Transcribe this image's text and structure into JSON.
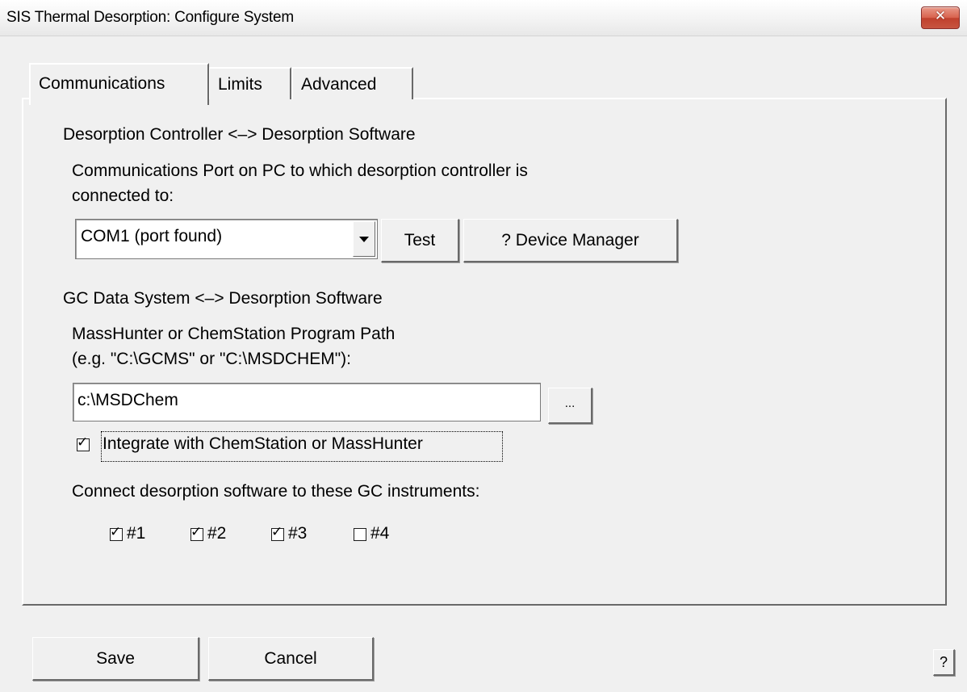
{
  "window": {
    "title": "SIS Thermal Desorption: Configure System",
    "close_glyph": "✕"
  },
  "tabs": [
    {
      "label": "Communications",
      "active": true
    },
    {
      "label": "Limits",
      "active": false
    },
    {
      "label": "Advanced",
      "active": false
    }
  ],
  "controller_group": {
    "legend": "Desorption Controller <–> Desorption Software",
    "port_label_line1": "Communications Port on PC to which desorption controller is",
    "port_label_line2": "connected to:",
    "port_value": "COM1 (port found)",
    "test_label": "Test",
    "device_manager_label": "? Device Manager"
  },
  "gc_group": {
    "legend": "GC Data System <–> Desorption Software",
    "path_label_line1": "MassHunter or ChemStation Program Path",
    "path_label_line2": "(e.g. \"C:\\GCMS\" or \"C:\\MSDCHEM\"):",
    "path_value": "c:\\MSDChem",
    "browse_label": "...",
    "integrate_label": "Integrate with ChemStation or MassHunter",
    "integrate_checked": true,
    "instruments_label": "Connect desorption software to these GC instruments:",
    "instruments": [
      {
        "label": "#1",
        "checked": true
      },
      {
        "label": "#2",
        "checked": true
      },
      {
        "label": "#3",
        "checked": true
      },
      {
        "label": "#4",
        "checked": false
      }
    ],
    "check_glyph": "✓"
  },
  "footer": {
    "save_label": "Save",
    "cancel_label": "Cancel",
    "help_label": "?"
  }
}
